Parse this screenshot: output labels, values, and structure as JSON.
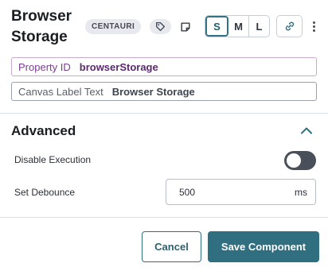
{
  "header": {
    "title_line1": "Browser",
    "title_line2": "Storage",
    "badge": "CENTAURI",
    "tag_icon": "tag-icon",
    "note_icon": "note-icon",
    "sizes": [
      "S",
      "M",
      "L"
    ],
    "selected_size": "S",
    "link_icon": "link-icon",
    "more_icon": "kebab-menu-icon"
  },
  "fields": {
    "property_id": {
      "label": "Property ID",
      "value": "browserStorage"
    },
    "canvas_label": {
      "label": "Canvas Label Text",
      "value": "Browser Storage"
    }
  },
  "advanced": {
    "title": "Advanced",
    "expanded": true,
    "disable_execution": {
      "label": "Disable Execution",
      "on": false
    },
    "debounce": {
      "label": "Set Debounce",
      "value": "500",
      "unit": "ms"
    }
  },
  "footer": {
    "cancel_label": "Cancel",
    "save_label": "Save Component"
  },
  "colors": {
    "accent": "#2f6f80",
    "property_border": "#c9a9d3",
    "property_label": "#7b3d8e",
    "toggle_off": "#4a5059"
  }
}
